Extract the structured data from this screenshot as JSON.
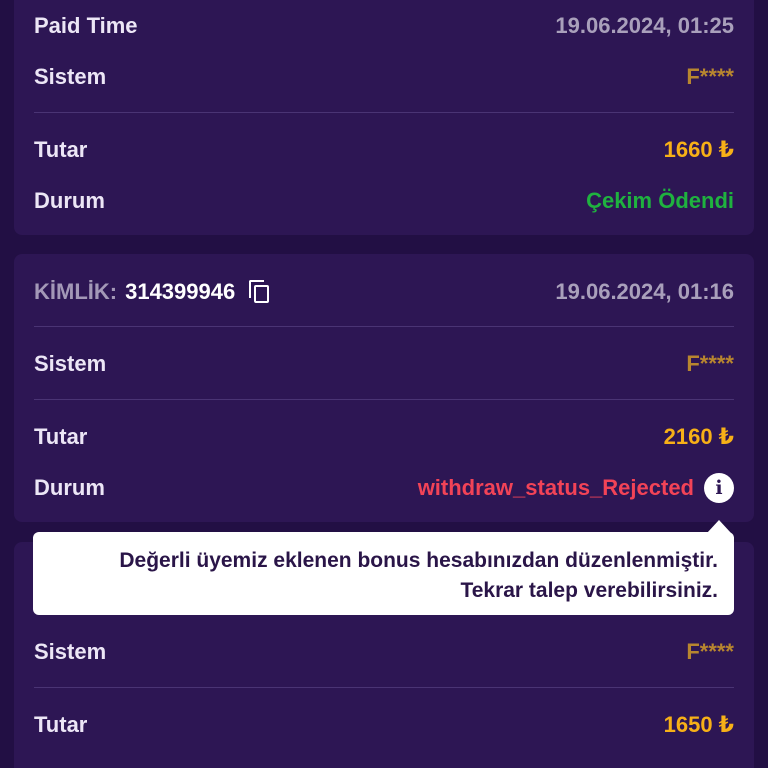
{
  "card1": {
    "paid_time_label": "Paid Time",
    "paid_time_value": "19.06.2024, 01:25",
    "system_label": "Sistem",
    "system_value": "F****",
    "amount_label": "Tutar",
    "amount_value": "1660 ₺",
    "status_label": "Durum",
    "status_value": "Çekim Ödendi"
  },
  "card2": {
    "id_label": "KİMLİK:",
    "id_value": "314399946",
    "date_value": "19.06.2024, 01:16",
    "system_label": "Sistem",
    "system_value": "F****",
    "amount_label": "Tutar",
    "amount_value": "2160 ₺",
    "status_label": "Durum",
    "status_value": "withdraw_status_Rejected"
  },
  "tooltip": {
    "line1": "Değerli üyemiz eklenen bonus hesabınızdan düzenlenmiştir.",
    "line2": "Tekrar talep verebilirsiniz."
  },
  "card3": {
    "system_label": "Sistem",
    "system_value": "F****",
    "amount_label": "Tutar",
    "amount_value": "1650 ₺"
  },
  "colors": {
    "background": "#220f44",
    "card": "#2d1654",
    "amount": "#f7b017",
    "paid": "#1fb23f",
    "rejected": "#f24357",
    "system": "#b8862f"
  }
}
